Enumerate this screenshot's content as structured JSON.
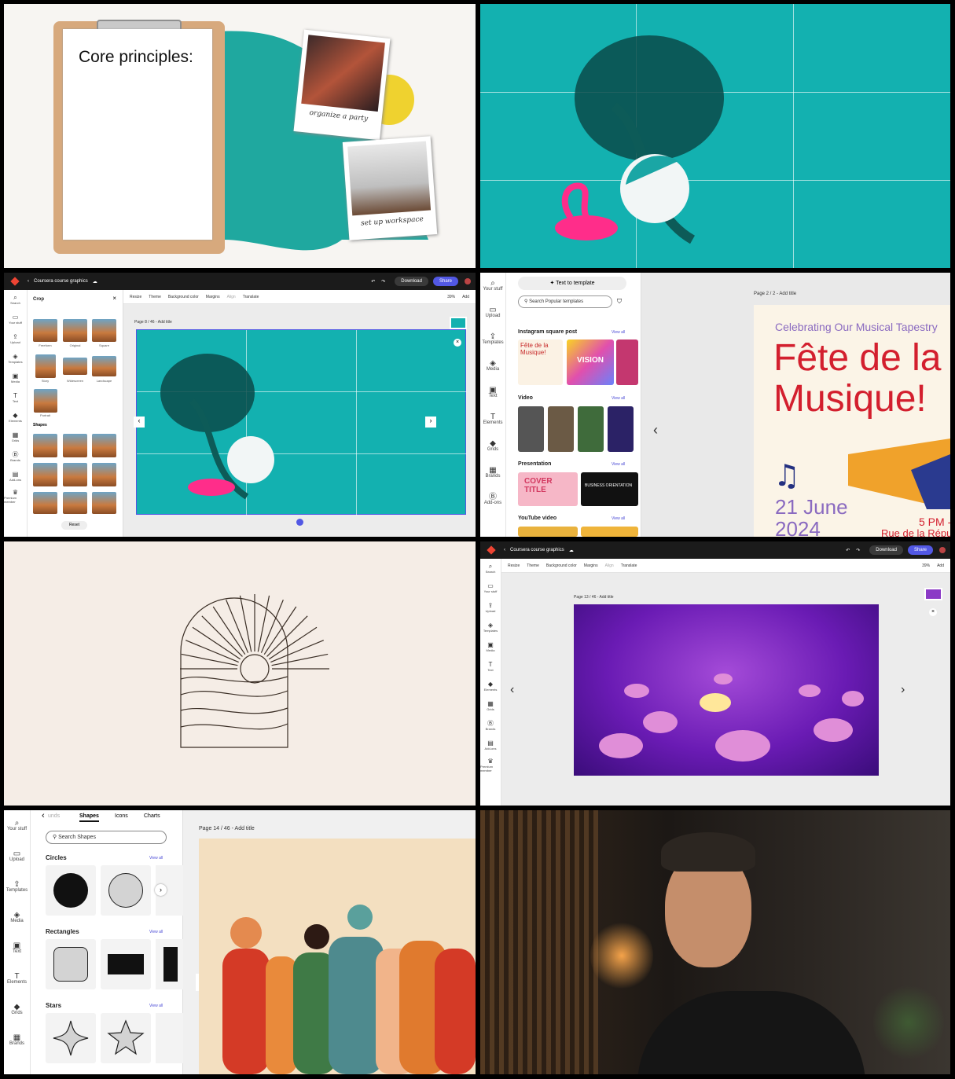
{
  "panel1": {
    "heading": "Core principles:",
    "photo1_caption": "organize a party",
    "photo2_caption": "set up workspace"
  },
  "panel3": {
    "app": {
      "doc_title": "Coursera course graphics",
      "download": "Download",
      "share": "Share"
    },
    "rail": [
      "Search",
      "Your stuff",
      "Upload",
      "Templates",
      "Media",
      "Text",
      "Elements",
      "Grids",
      "Brands",
      "Add-ons",
      "Premium member"
    ],
    "toolbar": [
      "Resize",
      "Theme",
      "Background color",
      "Margins",
      "Align",
      "Translate"
    ],
    "zoom": "39%",
    "add": "Add",
    "crop_panel": {
      "title": "Crop",
      "ratios": [
        "Freeform",
        "Original",
        "Square",
        "Story",
        "Widescreen",
        "Landscape",
        "Portrait"
      ],
      "shapes_label": "Shapes",
      "reset": "Reset"
    },
    "page_label": "Page 8 / 46 - Add title"
  },
  "panel4": {
    "text_to_template": "Text to template",
    "search_placeholder": "Search Popular templates",
    "rail": [
      "Your stuff",
      "Upload",
      "Templates",
      "Media",
      "Text",
      "Elements",
      "Grids",
      "Brands",
      "Add-ons"
    ],
    "sections": [
      {
        "title": "Instagram square post",
        "view_all": "View all"
      },
      {
        "title": "Video",
        "view_all": "View all"
      },
      {
        "title": "Presentation",
        "view_all": "View all"
      },
      {
        "title": "YouTube video",
        "view_all": "View all"
      }
    ],
    "thumbs": {
      "fete": "Fête de la Musique!",
      "vision": "VISION",
      "cover": "COVER TITLE",
      "business": "BUSINESS ORIENTATION"
    },
    "page_label": "Page 2 / 2 - Add title",
    "poster": {
      "subtitle": "Celebrating Our Musical Tapestry",
      "title_line1": "Fête de la",
      "title_line2": "Musique!",
      "date_line1": "21 June",
      "date_line2": "2024",
      "time": "5 PM -",
      "place": "Rue de la Répu"
    }
  },
  "panel6": {
    "app": {
      "doc_title": "Coursera course graphics",
      "download": "Download",
      "share": "Share"
    },
    "toolbar": [
      "Resize",
      "Theme",
      "Background color",
      "Margins",
      "Align",
      "Translate"
    ],
    "zoom": "39%",
    "add": "Add",
    "rail": [
      "Search",
      "Your stuff",
      "Upload",
      "Templates",
      "Media",
      "Text",
      "Elements",
      "Grids",
      "Brands",
      "Add-ons",
      "Premium member"
    ],
    "page_label": "Page 13 / 46 - Add title"
  },
  "panel7": {
    "tabs": [
      "unds",
      "Shapes",
      "Icons",
      "Charts"
    ],
    "search_placeholder": "Search Shapes",
    "rail": [
      "Your stuff",
      "Upload",
      "Templates",
      "Media",
      "Text",
      "Elements",
      "Grids",
      "Brands"
    ],
    "sections": [
      {
        "title": "Circles",
        "view_all": "View all"
      },
      {
        "title": "Rectangles",
        "view_all": "View all"
      },
      {
        "title": "Stars",
        "view_all": "View all"
      }
    ],
    "page_label": "Page 14 / 46 - Add title"
  },
  "colors": {
    "teal": "#13b1b0",
    "accent": "#5258e4",
    "dark": "#1b1b1b"
  }
}
